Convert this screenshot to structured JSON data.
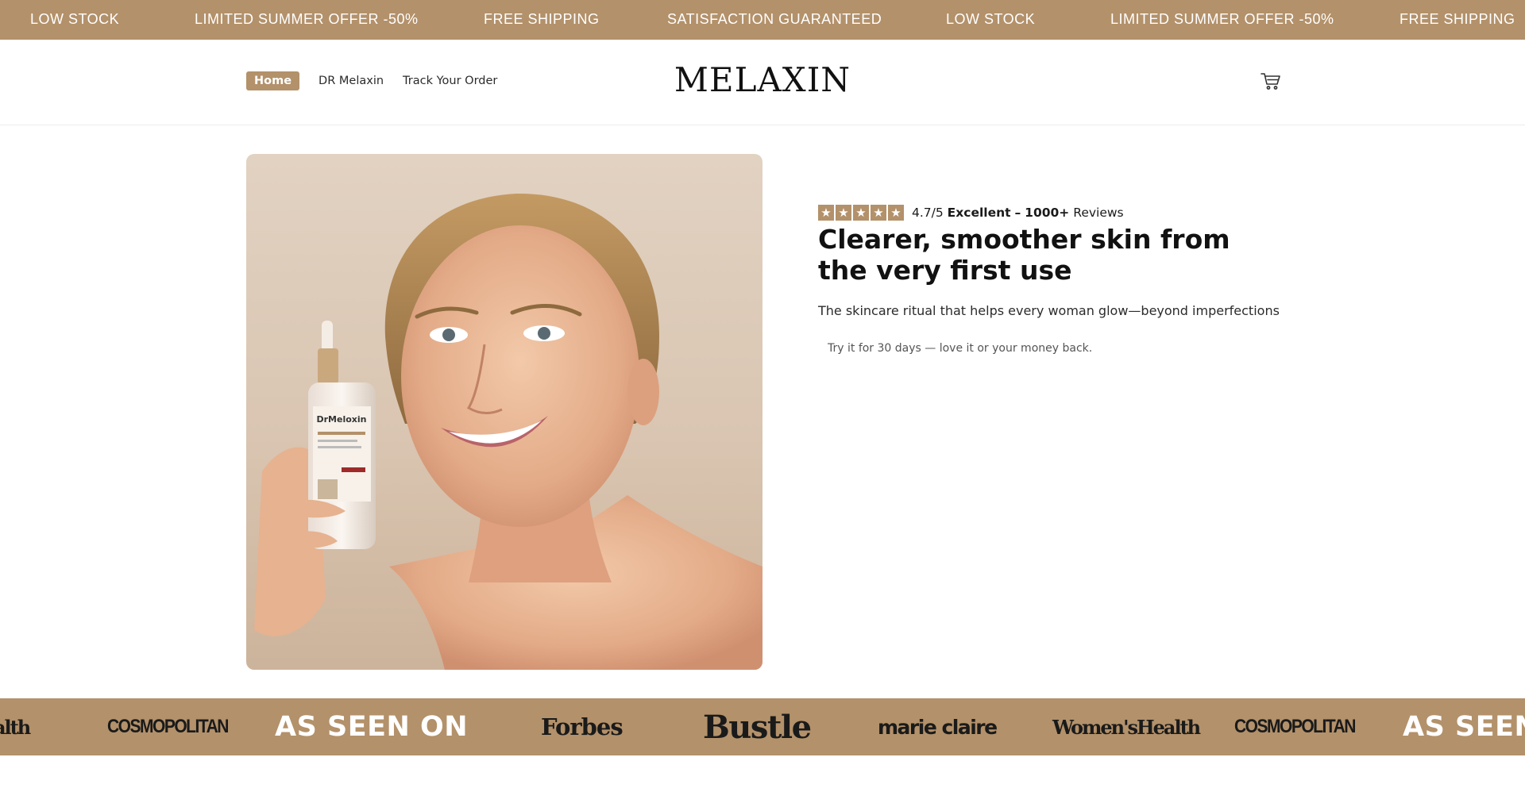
{
  "announcement": {
    "items": [
      "LOW STOCK",
      "LIMITED SUMMER OFFER -50%",
      "FREE SHIPPING",
      "SATISFACTION GUARANTEED",
      "LOW STOCK",
      "LIMITED SUMMER OFFER -50%",
      "FREE SHIPPING"
    ]
  },
  "header": {
    "nav": [
      {
        "label": "Home",
        "active": true
      },
      {
        "label": "DR Melaxin",
        "active": false
      },
      {
        "label": "Track Your Order",
        "active": false
      }
    ],
    "logo": "MELAXIN",
    "cart_icon": "cart-icon"
  },
  "hero": {
    "image_alt": "",
    "product_label": "DrMeloxin",
    "rating": {
      "stars": 5,
      "score": "4.7/5",
      "label": "Excellent",
      "separator": "–",
      "count": "1000+",
      "count_suffix": "Reviews"
    },
    "headline": "Clearer, smoother skin from the very first use",
    "subtitle": "The skincare ritual that helps every woman glow—beyond imperfections",
    "guarantee": "Try it for 30 days — love it or your money back."
  },
  "press": {
    "items": [
      "alth",
      "COSMOPOLITAN",
      "AS SEEN ON",
      "Forbes",
      "Bustle",
      "marie claire",
      "Women'sHealth",
      "COSMOPOLITAN",
      "AS SEEN"
    ]
  },
  "colors": {
    "accent": "#b3916a",
    "text": "#111111",
    "background": "#ffffff"
  }
}
